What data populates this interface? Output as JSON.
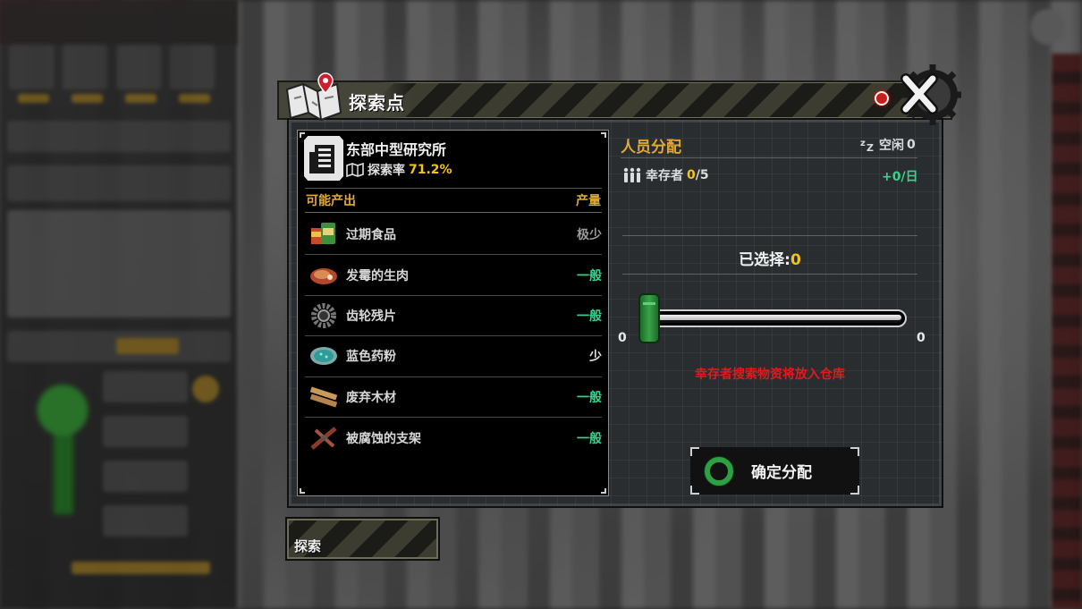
{
  "dialog": {
    "title": "探索点"
  },
  "location": {
    "name": "东部中型研究所",
    "explore_label": "探索率",
    "explore_rate": "71.2%"
  },
  "produce": {
    "header_label": "可能产出",
    "header_qty": "产量",
    "items": [
      {
        "name": "过期食品",
        "qty": "极少",
        "qty_color": "#9a9a9a",
        "icon": "food-can-icon"
      },
      {
        "name": "发霉的生肉",
        "qty": "一般",
        "qty_color": "#3ecf8e",
        "icon": "raw-meat-icon"
      },
      {
        "name": "齿轮残片",
        "qty": "一般",
        "qty_color": "#3ecf8e",
        "icon": "gear-fragment-icon"
      },
      {
        "name": "蓝色药粉",
        "qty": "少",
        "qty_color": "#e0e0e0",
        "icon": "blue-powder-icon"
      },
      {
        "name": "废弃木材",
        "qty": "一般",
        "qty_color": "#3ecf8e",
        "icon": "wood-plank-icon"
      },
      {
        "name": "被腐蚀的支架",
        "qty": "一般",
        "qty_color": "#3ecf8e",
        "icon": "corroded-bracket-icon"
      }
    ]
  },
  "personnel": {
    "title": "人员分配",
    "idle_label": "空闲",
    "idle_count": "0",
    "survivor_label": "幸存者",
    "survivor_assigned": "0",
    "survivor_total": "/5",
    "per_day": "+0/日",
    "selected_label": "已选择:",
    "selected_value": "0",
    "slider_min": "0",
    "slider_max": "0",
    "slider_value": 0,
    "notice": "幸存者搜索物资将放入仓库",
    "confirm_label": "确定分配"
  },
  "tabs": {
    "explore_label": "探索"
  },
  "colors": {
    "accent_orange": "#e0a93a",
    "accent_yellow": "#f0c419",
    "accent_green": "#3ecf8e",
    "warning_red": "#e01b1b"
  }
}
